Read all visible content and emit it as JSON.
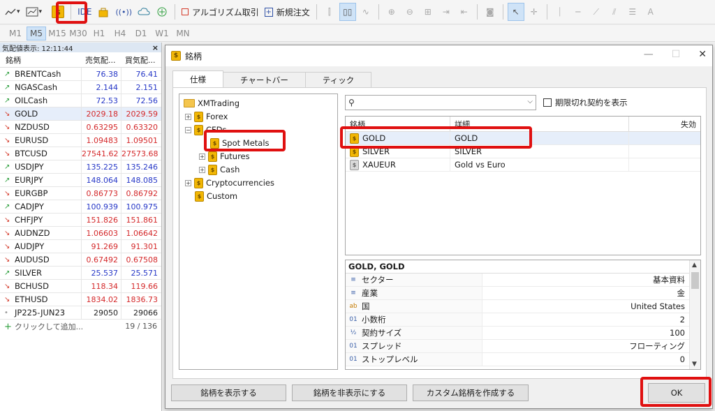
{
  "toolbar": {
    "ide_label": "IDE",
    "algo_label": "アルゴリズム取引",
    "neworder_label": "新規注文",
    "gold_icon_label": "$"
  },
  "timeframes": [
    "M1",
    "M5",
    "M15",
    "M30",
    "H1",
    "H4",
    "D1",
    "W1",
    "MN"
  ],
  "timeframe_active": "M5",
  "market_watch": {
    "title": "気配値表示: 12:11:44",
    "col_symbol": "銘柄",
    "col_bid": "売気配...",
    "col_ask": "買気配...",
    "rows": [
      {
        "symbol": "BRENTCash",
        "dir": "up",
        "bid": "76.38",
        "ask": "76.41",
        "color": "blue"
      },
      {
        "symbol": "NGASCash",
        "dir": "up",
        "bid": "2.144",
        "ask": "2.151",
        "color": "blue"
      },
      {
        "symbol": "OILCash",
        "dir": "up",
        "bid": "72.53",
        "ask": "72.56",
        "color": "blue"
      },
      {
        "symbol": "GOLD",
        "dir": "dn",
        "bid": "2029.18",
        "ask": "2029.59",
        "color": "red"
      },
      {
        "symbol": "NZDUSD",
        "dir": "dn",
        "bid": "0.63295",
        "ask": "0.63320",
        "color": "red"
      },
      {
        "symbol": "EURUSD",
        "dir": "dn",
        "bid": "1.09483",
        "ask": "1.09501",
        "color": "red"
      },
      {
        "symbol": "BTCUSD",
        "dir": "dn",
        "bid": "27541.62",
        "ask": "27573.68",
        "color": "red"
      },
      {
        "symbol": "USDJPY",
        "dir": "up",
        "bid": "135.225",
        "ask": "135.246",
        "color": "blue"
      },
      {
        "symbol": "EURJPY",
        "dir": "up",
        "bid": "148.064",
        "ask": "148.085",
        "color": "blue"
      },
      {
        "symbol": "EURGBP",
        "dir": "dn",
        "bid": "0.86773",
        "ask": "0.86792",
        "color": "red"
      },
      {
        "symbol": "CADJPY",
        "dir": "up",
        "bid": "100.939",
        "ask": "100.975",
        "color": "blue"
      },
      {
        "symbol": "CHFJPY",
        "dir": "dn",
        "bid": "151.826",
        "ask": "151.861",
        "color": "red"
      },
      {
        "symbol": "AUDNZD",
        "dir": "dn",
        "bid": "1.06603",
        "ask": "1.06642",
        "color": "red"
      },
      {
        "symbol": "AUDJPY",
        "dir": "dn",
        "bid": "91.269",
        "ask": "91.301",
        "color": "red"
      },
      {
        "symbol": "AUDUSD",
        "dir": "dn",
        "bid": "0.67492",
        "ask": "0.67508",
        "color": "red"
      },
      {
        "symbol": "SILVER",
        "dir": "up",
        "bid": "25.537",
        "ask": "25.571",
        "color": "blue"
      },
      {
        "symbol": "BCHUSD",
        "dir": "dn",
        "bid": "118.34",
        "ask": "119.66",
        "color": "red"
      },
      {
        "symbol": "ETHUSD",
        "dir": "dn",
        "bid": "1834.02",
        "ask": "1836.73",
        "color": "red"
      },
      {
        "symbol": "JP225-JUN23",
        "dir": "dot",
        "bid": "29050",
        "ask": "29066",
        "color": "dark"
      }
    ],
    "add_label": "クリックして追加...",
    "count": "19 / 136"
  },
  "dialog": {
    "title": "銘柄",
    "tabs": [
      "仕様",
      "チャートバー",
      "ティック"
    ],
    "tree": {
      "root": "XMTrading",
      "forex": "Forex",
      "cfds": "CFDs",
      "spot_metals": "Spot Metals",
      "futures": "Futures",
      "cash": "Cash",
      "crypto": "Cryptocurrencies",
      "custom": "Custom"
    },
    "search_placeholder": "",
    "expired_label": "期限切れ契約を表示",
    "list_headers": {
      "symbol": "銘柄",
      "detail": "詳細",
      "expiry": "失効"
    },
    "list_rows": [
      {
        "symbol": "GOLD",
        "detail": "GOLD",
        "coin": "gold"
      },
      {
        "symbol": "SILVER",
        "detail": "SILVER",
        "coin": "gold"
      },
      {
        "symbol": "XAUEUR",
        "detail": "Gold vs Euro",
        "coin": "grey"
      }
    ],
    "props_title": "GOLD, GOLD",
    "props": [
      {
        "icon": "≡",
        "key": "セクター",
        "value": "基本資料"
      },
      {
        "icon": "≡",
        "key": "産業",
        "value": "金"
      },
      {
        "icon": "ab",
        "key": "国",
        "value": "United States"
      },
      {
        "icon": "01",
        "key": "小数桁",
        "value": "2"
      },
      {
        "icon": "½",
        "key": "契約サイズ",
        "value": "100"
      },
      {
        "icon": "01",
        "key": "スプレッド",
        "value": "フローティング"
      },
      {
        "icon": "01",
        "key": "ストップレベル",
        "value": "0"
      }
    ],
    "btn_show": "銘柄を表示する",
    "btn_hide": "銘柄を非表示にする",
    "btn_custom": "カスタム銘柄を作成する",
    "btn_ok": "OK"
  },
  "colors": {
    "highlight": "#e01010",
    "gold": "#f2b705"
  }
}
